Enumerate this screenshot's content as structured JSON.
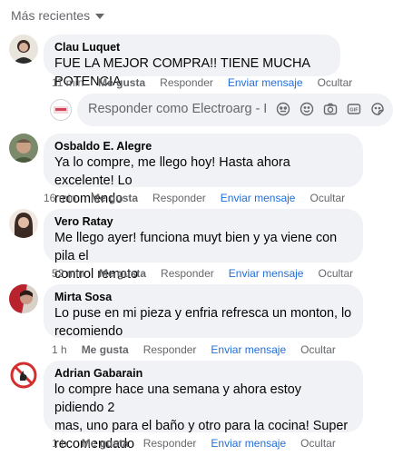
{
  "sort": {
    "label": "Más recientes"
  },
  "comments": [
    {
      "author": "Clau Luquet",
      "text": "FUE LA MEJOR COMPRA!! TIENE MUCHA POTENCIA",
      "time": "11 min"
    },
    {
      "author": "Osbaldo E. Alegre",
      "text": "Ya lo compre, me llego hoy! Hasta ahora excelente! Lo\nrecomiendo",
      "time": "16 min"
    },
    {
      "author": "Vero Ratay",
      "text": "Me llego ayer! funciona muyt bien y ya viene con pila el\ncontrol remoto",
      "time": "52 min"
    },
    {
      "author": "Mirta Sosa",
      "text": "Lo puse en mi pieza y enfria refresca un monton, lo\nrecomiendo",
      "time": "1 h"
    },
    {
      "author": "Adrian Gabarain",
      "text": "lo compre hace una semana y ahora estoy pidiendo 2\nmas, uno para el baño y otro para la cocina! Super\nrecomendado",
      "time": "1 h"
    }
  ],
  "actions": {
    "like": "Me gusta",
    "reply": "Responder",
    "message": "Enviar mensaje",
    "hide": "Ocultar"
  },
  "reply_box": {
    "placeholder": "Responder como Electroarg - P..."
  },
  "colors": {
    "bubble": "#f0f2f5",
    "link": "#216fdb",
    "muted": "#65676b"
  }
}
